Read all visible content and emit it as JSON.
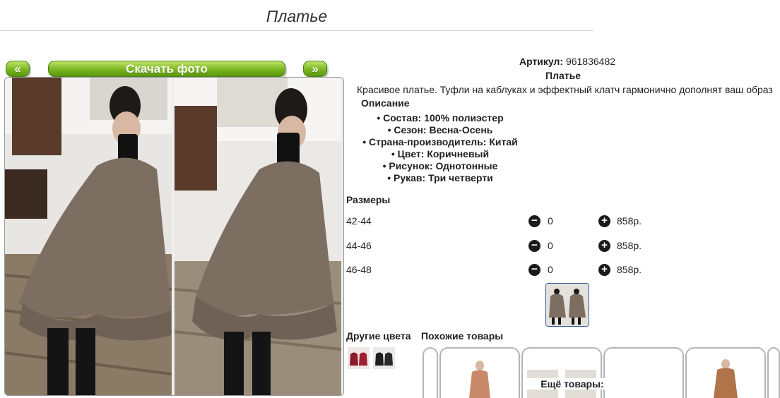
{
  "page": {
    "title": "Платье"
  },
  "buttons": {
    "prev": "«",
    "download": "Скачать фото",
    "next": "»"
  },
  "product": {
    "article_label": "Артикул:",
    "article_value": "961836482",
    "name": "Платье",
    "description": "Красивое платье. Туфли на каблуках и эффектный клатч гармонично дополнят ваш образ",
    "description_title": "Описание",
    "specs": [
      "Состав: 100% полиэстер",
      "Сезон: Весна-Осень",
      "Страна-производитель: Китай",
      "Цвет: Коричневый",
      "Рисунок: Однотонные",
      "Рукав: Три четверти"
    ]
  },
  "sizes": {
    "title": "Размеры",
    "rows": [
      {
        "size": "42-44",
        "qty": "0",
        "price": "858р."
      },
      {
        "size": "44-46",
        "qty": "0",
        "price": "858р."
      },
      {
        "size": "46-48",
        "qty": "0",
        "price": "858р."
      }
    ]
  },
  "sections": {
    "other_colors": "Другие цвета",
    "similar": "Похожие товары",
    "more_goods": "Ещё товары:"
  },
  "colors": {
    "accent_green": "#7ab520",
    "dress": "#7d6e62",
    "button_dark": "#1a1a1a"
  },
  "icons": [
    "minus-circle-icon",
    "plus-circle-icon"
  ]
}
